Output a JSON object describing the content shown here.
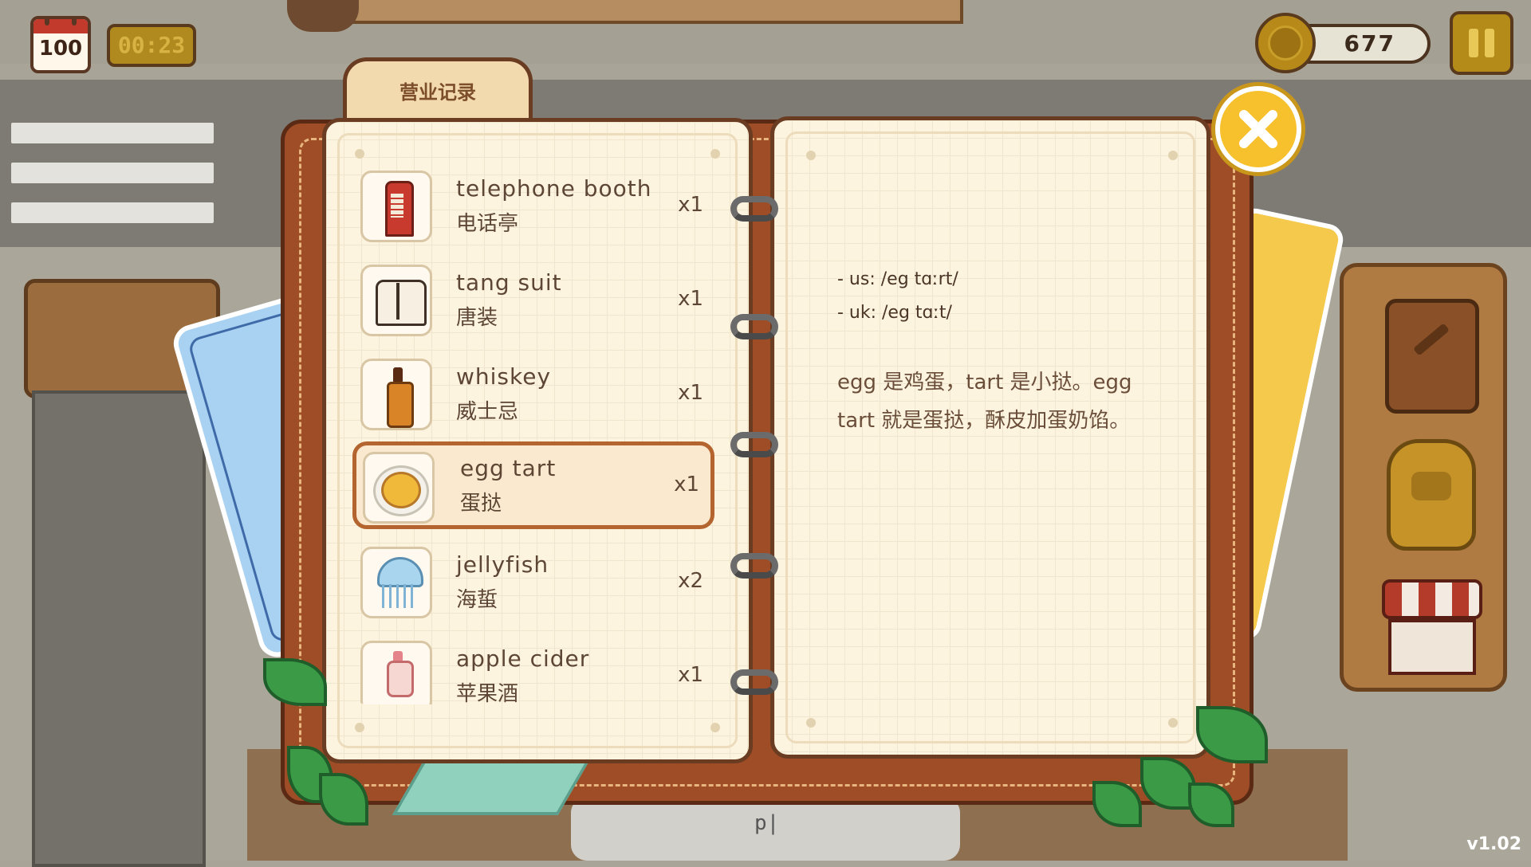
{
  "hud": {
    "day": "100",
    "timer": "00:23",
    "coins": "677"
  },
  "notebook": {
    "tab_label": "营业记录",
    "items": [
      {
        "en": "telephone booth",
        "cn": "电话亭",
        "qty": "x1",
        "icon": "telephone-booth-icon"
      },
      {
        "en": "tang suit",
        "cn": "唐装",
        "qty": "x1",
        "icon": "tang-suit-icon"
      },
      {
        "en": "whiskey",
        "cn": "威士忌",
        "qty": "x1",
        "icon": "whiskey-bottle-icon"
      },
      {
        "en": "egg tart",
        "cn": "蛋挞",
        "qty": "x1",
        "icon": "egg-tart-icon"
      },
      {
        "en": "jellyfish",
        "cn": "海蜇",
        "qty": "x2",
        "icon": "jellyfish-icon"
      },
      {
        "en": "apple cider",
        "cn": "苹果酒",
        "qty": "x1",
        "icon": "apple-cider-icon"
      }
    ],
    "selected_index": 3,
    "detail": {
      "us_pron": "- us: /eg tɑːrt/",
      "uk_pron": "- uk: /eg tɑːt/",
      "explanation_line1": "egg 是鸡蛋，tart 是小挞。egg",
      "explanation_line2": "tart 就是蛋挞，酥皮加蛋奶馅。"
    }
  },
  "bottom_label": "p|",
  "version": "v1.02",
  "colors": {
    "page": "#fdf4e0",
    "cover": "#9f4d26",
    "accent_gold": "#f6c12d",
    "selected_border": "#b4642e"
  }
}
